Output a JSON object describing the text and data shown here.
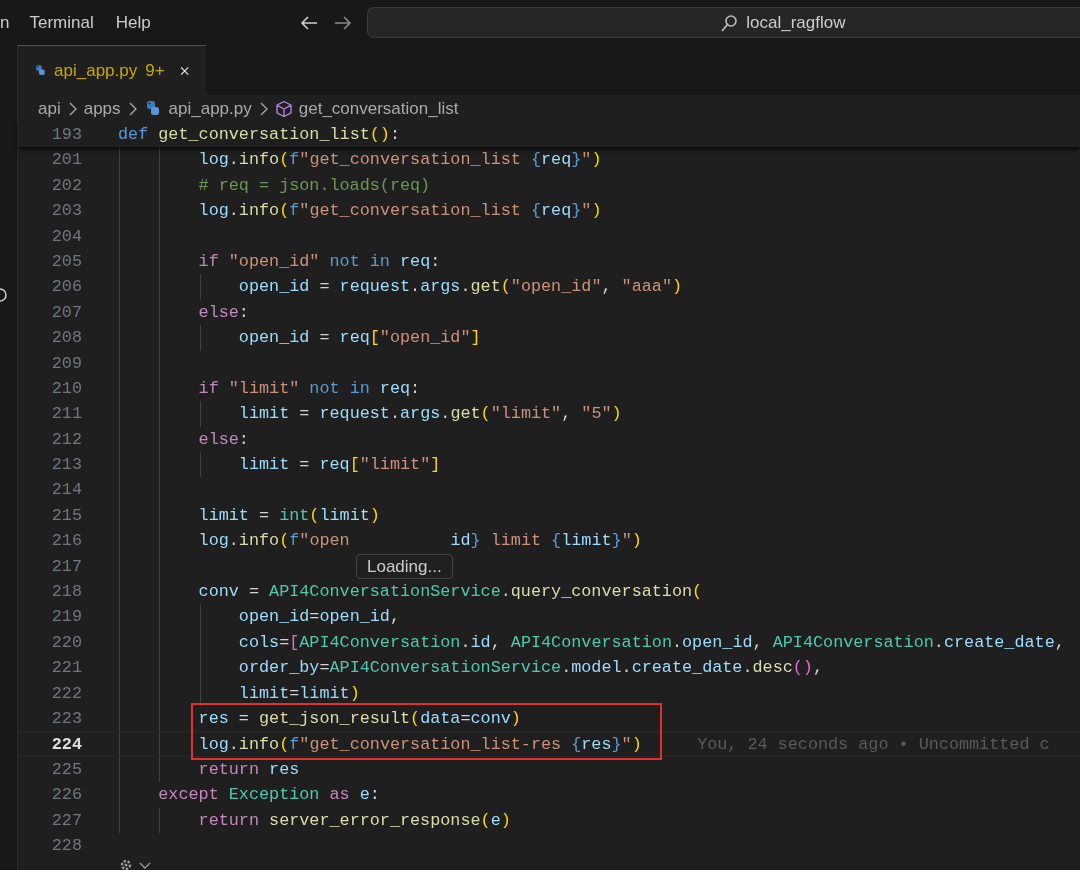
{
  "menu": [
    {
      "label": "n"
    },
    {
      "label": "Terminal"
    },
    {
      "label": "Help"
    }
  ],
  "command_center": {
    "text": "local_ragflow"
  },
  "tabs": [
    {
      "label": "api_app.py",
      "problems": "9+",
      "selected": true
    }
  ],
  "breadcrumb": [
    "api",
    "apps",
    "api_app.py",
    "get_conversation_list"
  ],
  "sticky_line": {
    "number": "193",
    "tokens": [
      {
        "kind": "kw",
        "text": "def "
      },
      {
        "kind": "fn",
        "text": "get_conversation_list"
      },
      {
        "kind": "b1",
        "text": "()"
      },
      {
        "kind": "p",
        "text": ":"
      }
    ]
  },
  "lines": [
    {
      "number": "201",
      "current": false,
      "boxed": false,
      "tokens": [
        {
          "kind": "var",
          "text": "        log"
        },
        {
          "kind": "p",
          "text": "."
        },
        {
          "kind": "fn",
          "text": "info"
        },
        {
          "kind": "b1",
          "text": "("
        },
        {
          "kind": "kw",
          "text": "f"
        },
        {
          "kind": "str",
          "text": "\"get_conversation_list "
        },
        {
          "kind": "fb",
          "text": "{"
        },
        {
          "kind": "var",
          "text": "req"
        },
        {
          "kind": "fb",
          "text": "}"
        },
        {
          "kind": "str",
          "text": "\""
        },
        {
          "kind": "b1",
          "text": ")"
        }
      ]
    },
    {
      "number": "202",
      "current": false,
      "boxed": false,
      "tokens": [
        {
          "kind": "cm",
          "text": "        # req = json.loads(req)"
        }
      ]
    },
    {
      "number": "203",
      "current": false,
      "boxed": false,
      "tokens": [
        {
          "kind": "var",
          "text": "        log"
        },
        {
          "kind": "p",
          "text": "."
        },
        {
          "kind": "fn",
          "text": "info"
        },
        {
          "kind": "b1",
          "text": "("
        },
        {
          "kind": "kw",
          "text": "f"
        },
        {
          "kind": "str",
          "text": "\"get_conversation_list "
        },
        {
          "kind": "fb",
          "text": "{"
        },
        {
          "kind": "var",
          "text": "req"
        },
        {
          "kind": "fb",
          "text": "}"
        },
        {
          "kind": "str",
          "text": "\""
        },
        {
          "kind": "b1",
          "text": ")"
        }
      ]
    },
    {
      "number": "204",
      "current": false
    },
    {
      "number": "205",
      "current": false,
      "boxed": false,
      "tokens": [
        {
          "kind": "ctl",
          "text": "        if "
        },
        {
          "kind": "str",
          "text": "\"open_id\""
        },
        {
          "kind": "kw",
          "text": " not in "
        },
        {
          "kind": "var",
          "text": "req"
        },
        {
          "kind": "p",
          "text": ":"
        }
      ]
    },
    {
      "number": "206",
      "current": false,
      "boxed": false,
      "tokens": [
        {
          "kind": "var",
          "text": "            open_id"
        },
        {
          "kind": "p",
          "text": " = "
        },
        {
          "kind": "var",
          "text": "request"
        },
        {
          "kind": "p",
          "text": "."
        },
        {
          "kind": "var",
          "text": "args"
        },
        {
          "kind": "p",
          "text": "."
        },
        {
          "kind": "fn",
          "text": "get"
        },
        {
          "kind": "b1",
          "text": "("
        },
        {
          "kind": "str",
          "text": "\"open_id\""
        },
        {
          "kind": "p",
          "text": ", "
        },
        {
          "kind": "str",
          "text": "\"aaa\""
        },
        {
          "kind": "b1",
          "text": ")"
        }
      ]
    },
    {
      "number": "207",
      "current": false,
      "boxed": false,
      "tokens": [
        {
          "kind": "ctl",
          "text": "        else"
        },
        {
          "kind": "p",
          "text": ":"
        }
      ]
    },
    {
      "number": "208",
      "current": false,
      "boxed": false,
      "tokens": [
        {
          "kind": "var",
          "text": "            open_id"
        },
        {
          "kind": "p",
          "text": " = "
        },
        {
          "kind": "var",
          "text": "req"
        },
        {
          "kind": "b1",
          "text": "["
        },
        {
          "kind": "str",
          "text": "\"open_id\""
        },
        {
          "kind": "b1",
          "text": "]"
        }
      ]
    },
    {
      "number": "209",
      "current": false
    },
    {
      "number": "210",
      "current": false,
      "boxed": false,
      "tokens": [
        {
          "kind": "ctl",
          "text": "        if "
        },
        {
          "kind": "str",
          "text": "\"limit\""
        },
        {
          "kind": "kw",
          "text": " not in "
        },
        {
          "kind": "var",
          "text": "req"
        },
        {
          "kind": "p",
          "text": ":"
        }
      ]
    },
    {
      "number": "211",
      "current": false,
      "boxed": false,
      "tokens": [
        {
          "kind": "var",
          "text": "            limit"
        },
        {
          "kind": "p",
          "text": " = "
        },
        {
          "kind": "var",
          "text": "request"
        },
        {
          "kind": "p",
          "text": "."
        },
        {
          "kind": "var",
          "text": "args"
        },
        {
          "kind": "p",
          "text": "."
        },
        {
          "kind": "fn",
          "text": "get"
        },
        {
          "kind": "b1",
          "text": "("
        },
        {
          "kind": "str",
          "text": "\"limit\""
        },
        {
          "kind": "p",
          "text": ", "
        },
        {
          "kind": "str",
          "text": "\"5\""
        },
        {
          "kind": "b1",
          "text": ")"
        }
      ]
    },
    {
      "number": "212",
      "current": false,
      "boxed": false,
      "tokens": [
        {
          "kind": "ctl",
          "text": "        else"
        },
        {
          "kind": "p",
          "text": ":"
        }
      ]
    },
    {
      "number": "213",
      "current": false,
      "boxed": false,
      "tokens": [
        {
          "kind": "var",
          "text": "            limit"
        },
        {
          "kind": "p",
          "text": " = "
        },
        {
          "kind": "var",
          "text": "req"
        },
        {
          "kind": "b1",
          "text": "["
        },
        {
          "kind": "str",
          "text": "\"limit\""
        },
        {
          "kind": "b1",
          "text": "]"
        }
      ]
    },
    {
      "number": "214",
      "current": false
    },
    {
      "number": "215",
      "current": false,
      "boxed": false,
      "tokens": [
        {
          "kind": "var",
          "text": "        limit"
        },
        {
          "kind": "p",
          "text": " = "
        },
        {
          "kind": "cls",
          "text": "int"
        },
        {
          "kind": "b1",
          "text": "("
        },
        {
          "kind": "var",
          "text": "limit"
        },
        {
          "kind": "b1",
          "text": ")"
        }
      ]
    },
    {
      "number": "216",
      "current": false,
      "boxed": false,
      "tokens": [
        {
          "kind": "var",
          "text": "        log"
        },
        {
          "kind": "p",
          "text": "."
        },
        {
          "kind": "fn",
          "text": "info"
        },
        {
          "kind": "b1",
          "text": "("
        },
        {
          "kind": "kw",
          "text": "f"
        },
        {
          "kind": "str",
          "text": "\"open"
        },
        {
          "kind": "hidden"
        },
        {
          "kind": "var",
          "text": "id"
        },
        {
          "kind": "fb",
          "text": "}"
        },
        {
          "kind": "str",
          "text": " limit "
        },
        {
          "kind": "fb",
          "text": "{"
        },
        {
          "kind": "var",
          "text": "limit"
        },
        {
          "kind": "fb",
          "text": "}"
        },
        {
          "kind": "str",
          "text": "\""
        },
        {
          "kind": "b1",
          "text": ")"
        }
      ]
    },
    {
      "number": "217",
      "current": false
    },
    {
      "number": "218",
      "current": false,
      "boxed": false,
      "tokens": [
        {
          "kind": "var",
          "text": "        conv"
        },
        {
          "kind": "p",
          "text": " = "
        },
        {
          "kind": "cls",
          "text": "API4ConversationService"
        },
        {
          "kind": "p",
          "text": "."
        },
        {
          "kind": "fn",
          "text": "query_conversation"
        },
        {
          "kind": "b1",
          "text": "("
        }
      ]
    },
    {
      "number": "219",
      "current": false,
      "boxed": false,
      "tokens": [
        {
          "kind": "var",
          "text": "            open_id"
        },
        {
          "kind": "p",
          "text": "="
        },
        {
          "kind": "var",
          "text": "open_id"
        },
        {
          "kind": "p",
          "text": ","
        }
      ]
    },
    {
      "number": "220",
      "current": false,
      "boxed": false,
      "tokens": [
        {
          "kind": "var",
          "text": "            cols"
        },
        {
          "kind": "p",
          "text": "="
        },
        {
          "kind": "b2",
          "text": "["
        },
        {
          "kind": "cls",
          "text": "API4Conversation"
        },
        {
          "kind": "p",
          "text": "."
        },
        {
          "kind": "var",
          "text": "id"
        },
        {
          "kind": "p",
          "text": ", "
        },
        {
          "kind": "cls",
          "text": "API4Conversation"
        },
        {
          "kind": "p",
          "text": "."
        },
        {
          "kind": "var",
          "text": "open_id"
        },
        {
          "kind": "p",
          "text": ", "
        },
        {
          "kind": "cls",
          "text": "API4Conversation"
        },
        {
          "kind": "p",
          "text": "."
        },
        {
          "kind": "var",
          "text": "create_date"
        },
        {
          "kind": "p",
          "text": ","
        }
      ]
    },
    {
      "number": "221",
      "current": false,
      "boxed": false,
      "tokens": [
        {
          "kind": "var",
          "text": "            order_by"
        },
        {
          "kind": "p",
          "text": "="
        },
        {
          "kind": "cls",
          "text": "API4ConversationService"
        },
        {
          "kind": "p",
          "text": "."
        },
        {
          "kind": "var",
          "text": "model"
        },
        {
          "kind": "p",
          "text": "."
        },
        {
          "kind": "var",
          "text": "create_date"
        },
        {
          "kind": "p",
          "text": "."
        },
        {
          "kind": "fn",
          "text": "desc"
        },
        {
          "kind": "b2",
          "text": "()"
        },
        {
          "kind": "p",
          "text": ","
        }
      ]
    },
    {
      "number": "222",
      "current": false,
      "boxed": false,
      "tokens": [
        {
          "kind": "var",
          "text": "            limit"
        },
        {
          "kind": "p",
          "text": "="
        },
        {
          "kind": "var",
          "text": "limit"
        },
        {
          "kind": "b1",
          "text": ")"
        }
      ]
    },
    {
      "number": "223",
      "current": false,
      "boxed": true,
      "tokens": [
        {
          "kind": "var",
          "text": "        res"
        },
        {
          "kind": "p",
          "text": " = "
        },
        {
          "kind": "fn",
          "text": "get_json_result"
        },
        {
          "kind": "b1",
          "text": "("
        },
        {
          "kind": "var",
          "text": "data"
        },
        {
          "kind": "p",
          "text": "="
        },
        {
          "kind": "var",
          "text": "conv"
        },
        {
          "kind": "b1",
          "text": ")"
        }
      ]
    },
    {
      "number": "224",
      "current": true,
      "boxed": true,
      "blame": "You, 24 seconds ago • Uncommitted c",
      "tokens": [
        {
          "kind": "var",
          "text": "        log"
        },
        {
          "kind": "p",
          "text": "."
        },
        {
          "kind": "fn",
          "text": "info"
        },
        {
          "kind": "b1",
          "text": "("
        },
        {
          "kind": "kw",
          "text": "f"
        },
        {
          "kind": "str",
          "text": "\"get_conversation_list-res "
        },
        {
          "kind": "fb",
          "text": "{"
        },
        {
          "kind": "var",
          "text": "res"
        },
        {
          "kind": "fb",
          "text": "}"
        },
        {
          "kind": "str",
          "text": "\""
        },
        {
          "kind": "b1",
          "text": ")"
        }
      ]
    },
    {
      "number": "225",
      "current": false,
      "boxed": false,
      "tokens": [
        {
          "kind": "ctl",
          "text": "        return "
        },
        {
          "kind": "var",
          "text": "res"
        }
      ]
    },
    {
      "number": "226",
      "current": false,
      "boxed": false,
      "tokens": [
        {
          "kind": "ctl",
          "text": "    except "
        },
        {
          "kind": "cls",
          "text": "Exception "
        },
        {
          "kind": "ctl",
          "text": "as "
        },
        {
          "kind": "var",
          "text": "e"
        },
        {
          "kind": "p",
          "text": ":"
        }
      ]
    },
    {
      "number": "227",
      "current": false,
      "boxed": false,
      "tokens": [
        {
          "kind": "ctl",
          "text": "        return "
        },
        {
          "kind": "fn",
          "text": "server_error_response"
        },
        {
          "kind": "b1",
          "text": "("
        },
        {
          "kind": "var",
          "text": "e"
        },
        {
          "kind": "b1",
          "text": ")"
        }
      ]
    },
    {
      "number": "228",
      "current": false
    }
  ],
  "hover_tooltip": {
    "text": "Loading..."
  }
}
